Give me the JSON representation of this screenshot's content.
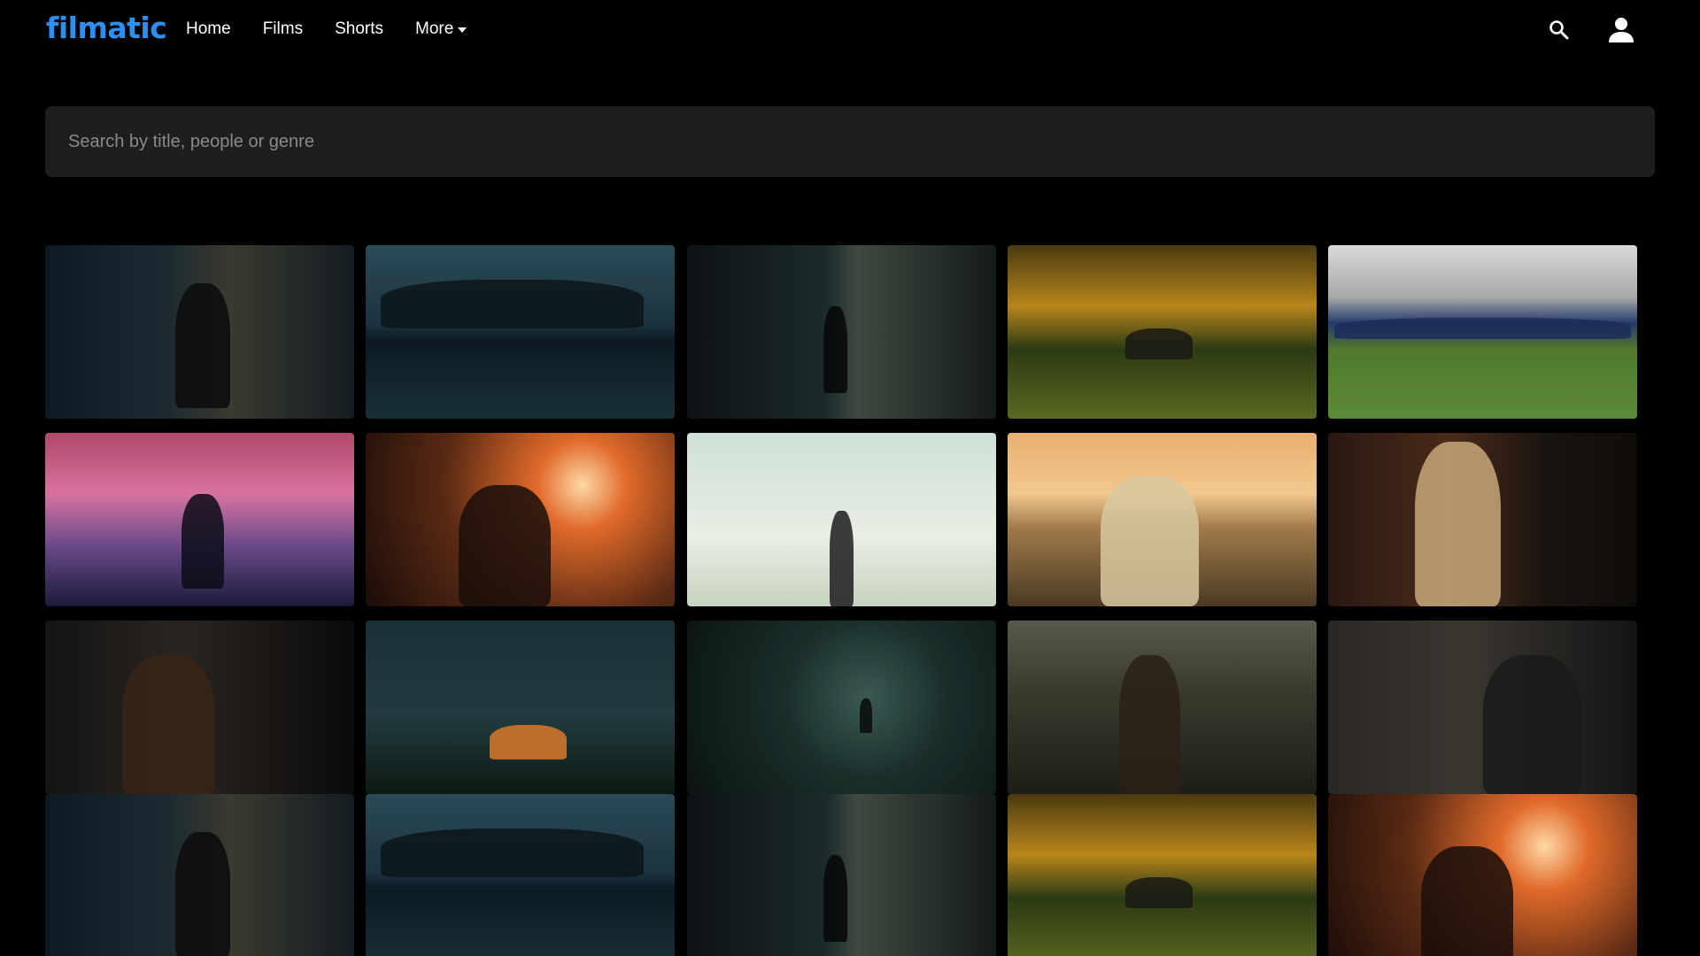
{
  "brand": {
    "name": "filmatic",
    "color": "#2d8ff0"
  },
  "nav": {
    "items": [
      {
        "label": "Home"
      },
      {
        "label": "Films"
      },
      {
        "label": "Shorts"
      },
      {
        "label": "More",
        "has_dropdown": true
      }
    ]
  },
  "header": {
    "search_icon": "search-icon",
    "user_icon": "user-icon"
  },
  "search": {
    "placeholder": "Search by title, people or genre",
    "value": ""
  },
  "thumbnails": [
    {
      "scene": "woman-in-dark-hall"
    },
    {
      "scene": "city-skyline-dusk"
    },
    {
      "scene": "man-in-tunnel"
    },
    {
      "scene": "autumn-tree-bench"
    },
    {
      "scene": "crowd-on-field"
    },
    {
      "scene": "pink-sky-silhouette"
    },
    {
      "scene": "smoke-orange-light"
    },
    {
      "scene": "man-in-palm-trees"
    },
    {
      "scene": "man-at-sea-sunset"
    },
    {
      "scene": "blonde-woman-bus"
    },
    {
      "scene": "woman-night-balcony"
    },
    {
      "scene": "campfire-at-dusk"
    },
    {
      "scene": "foggy-forest"
    },
    {
      "scene": "woman-in-field"
    },
    {
      "scene": "man-smoking-alley"
    },
    {
      "scene": "woman-in-dark-hall"
    },
    {
      "scene": "city-skyline-dusk"
    },
    {
      "scene": "man-in-tunnel"
    },
    {
      "scene": "autumn-tree-bench"
    },
    {
      "scene": "smoke-orange-light"
    }
  ]
}
